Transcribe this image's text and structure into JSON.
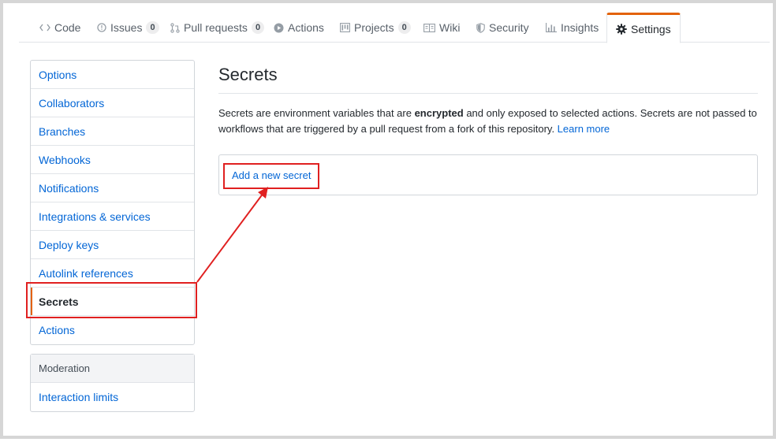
{
  "tabs": [
    {
      "label": "Code",
      "icon": "code-icon"
    },
    {
      "label": "Issues",
      "icon": "issue-icon",
      "count": "0"
    },
    {
      "label": "Pull requests",
      "icon": "pull-request-icon",
      "count": "0"
    },
    {
      "label": "Actions",
      "icon": "play-icon"
    },
    {
      "label": "Projects",
      "icon": "project-icon",
      "count": "0"
    },
    {
      "label": "Wiki",
      "icon": "book-icon"
    },
    {
      "label": "Security",
      "icon": "shield-icon"
    },
    {
      "label": "Insights",
      "icon": "graph-icon"
    },
    {
      "label": "Settings",
      "icon": "gear-icon",
      "selected": true
    }
  ],
  "sidebar": {
    "items": [
      "Options",
      "Collaborators",
      "Branches",
      "Webhooks",
      "Notifications",
      "Integrations & services",
      "Deploy keys",
      "Autolink references",
      "Secrets",
      "Actions"
    ],
    "selected": "Secrets",
    "moderation_heading": "Moderation",
    "moderation_items": [
      "Interaction limits"
    ]
  },
  "main": {
    "title": "Secrets",
    "description_before": "Secrets are environment variables that are ",
    "description_bold": "encrypted",
    "description_after": " and only exposed to selected actions. Secrets are not passed to workflows that are triggered by a pull request from a fork of this repository. ",
    "learn_more": "Learn more",
    "add_secret_label": "Add a new secret"
  },
  "colors": {
    "link": "#0366d6",
    "accent": "#e36209",
    "annotation": "#e02020"
  }
}
